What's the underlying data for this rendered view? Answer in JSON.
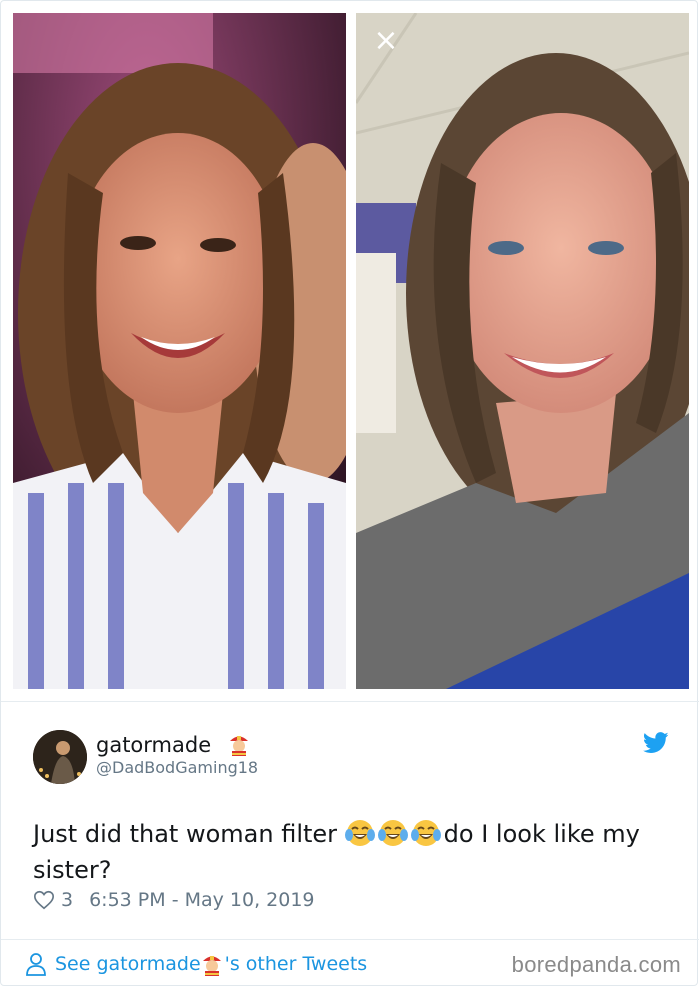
{
  "photos": {
    "close_glyph": "×",
    "left_shirt_stripe_color": "#7f84c8",
    "right_shirt_accent_color": "#2845a8"
  },
  "tweet": {
    "display_name": "gatormade",
    "handle": "@DadBodGaming18",
    "text_before_emoji": "Just did that woman filter ",
    "text_after_emoji": "do I look like my sister?",
    "emoji_names": [
      "face-with-tears-of-joy",
      "face-with-tears-of-joy",
      "face-with-tears-of-joy"
    ],
    "likes": "3",
    "timestamp": "6:53 PM - May 10, 2019",
    "icon_names": {
      "bird": "twitter-bird-icon",
      "heart": "heart-icon",
      "person": "person-icon",
      "name_emoji": "firefighter-emoji-icon"
    },
    "accent_color": "#1da1f2"
  },
  "footer": {
    "see_prefix": "See gatormade ",
    "see_suffix": "'s other Tweets"
  },
  "watermark": "boredpanda.com"
}
